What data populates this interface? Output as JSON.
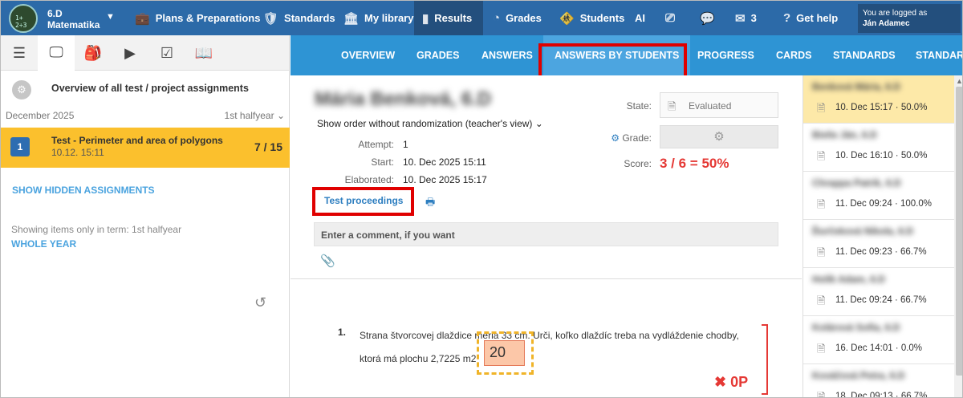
{
  "topnav": {
    "class_line1": "6.D",
    "class_line2": "Matematika",
    "items": [
      {
        "label": "Plans & Preparations",
        "icon": "briefcase-icon"
      },
      {
        "label": "Standards",
        "icon": "shield-icon"
      },
      {
        "label": "My library",
        "icon": "library-icon"
      },
      {
        "label": "Results",
        "icon": "bar-chart-icon"
      },
      {
        "label": "Grades",
        "icon": "grades-icon"
      },
      {
        "label": "Students",
        "icon": "students-icon"
      },
      {
        "label": "AI",
        "icon": ""
      },
      {
        "label": "",
        "icon": "cast-icon"
      },
      {
        "label": "",
        "icon": "chat-icon"
      },
      {
        "label": "3",
        "icon": "mail-icon"
      },
      {
        "label": "Get help",
        "icon": "help-icon"
      }
    ],
    "logged_label": "You are logged as",
    "logged_user": "Ján Adamec"
  },
  "left": {
    "overview_title": "Overview of all test / project assignments",
    "month": "December 2025",
    "term_select": "1st halfyear",
    "assignment": {
      "number": "1",
      "title": "Test - Perimeter and area of polygons",
      "date": "10.12. 15:11",
      "count": "7 / 15"
    },
    "show_hidden": "SHOW HIDDEN ASSIGNMENTS",
    "term_note": "Showing items only in term: 1st halfyear",
    "whole_year": "WHOLE YEAR"
  },
  "subnav": {
    "items": [
      "OVERVIEW",
      "GRADES",
      "ANSWERS",
      "ANSWERS BY STUDENTS",
      "PROGRESS",
      "CARDS",
      "STANDARDS",
      "STANDAR"
    ]
  },
  "detail": {
    "student_name": "Mária Benková, 6.D",
    "order_select": "Show order without randomization (teacher's view)",
    "attempt_label": "Attempt:",
    "attempt": "1",
    "start_label": "Start:",
    "start": "10. Dec 2025 15:11",
    "elaborated_label": "Elaborated:",
    "elaborated": "10. Dec 2025 15:17",
    "test_proceedings": "Test proceedings",
    "comment_placeholder": "Enter a comment, if you want",
    "state_label": "State:",
    "state": "Evaluated",
    "grade_label": "Grade:",
    "score_label": "Score:",
    "score": "3 / 6 = 50%"
  },
  "question": {
    "number": "1.",
    "text": "Strana štvorcovej dlaždice meria 33 cm. Urči, koľko dlaždíc treba na vydláždenie chodby, ktorá má plochu 2,7225 m2",
    "answer": "20",
    "points": "0P"
  },
  "students": [
    {
      "name": "Benková Mária, 6.D",
      "info": "10. Dec 15:17 · 50.0%",
      "selected": true
    },
    {
      "name": "Bieliк Jān, 6.D",
      "info": "10. Dec 16:10 · 50.0%",
      "selected": false
    },
    {
      "name": "Chrappa Patrik, 6.D",
      "info": "11. Dec 09:24 · 100.0%",
      "selected": false
    },
    {
      "name": "Ďurčeková Nikola, 6.D",
      "info": "11. Dec 09:23 · 66.7%",
      "selected": false
    },
    {
      "name": "Holík Adam, 6.D",
      "info": "11. Dec 09:24 · 66.7%",
      "selected": false
    },
    {
      "name": "Kolárová Sofia, 6.D",
      "info": "16. Dec 14:01 · 0.0%",
      "selected": false
    },
    {
      "name": "Kováčová Petra, 6.D",
      "info": "18. Dec 09:13 · 66.7%",
      "selected": false
    }
  ]
}
